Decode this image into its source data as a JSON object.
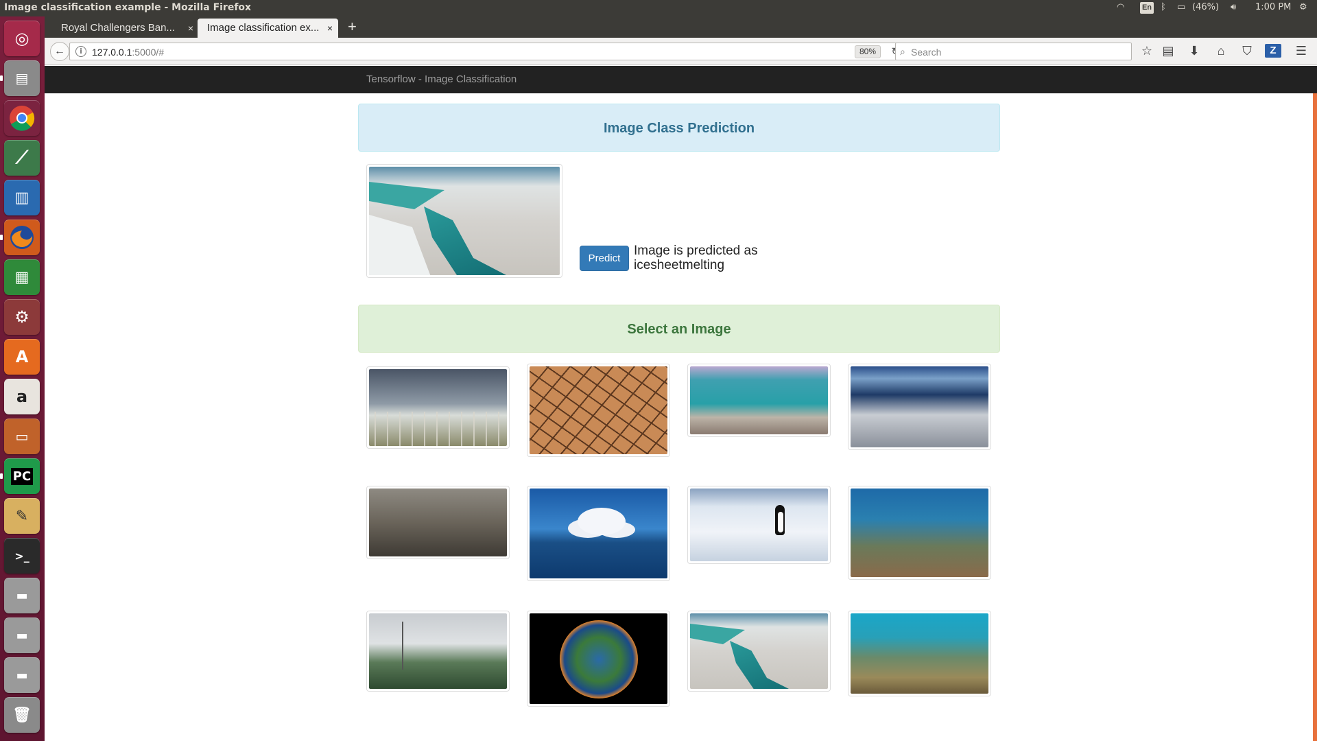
{
  "system_panel": {
    "window_title": "Image classification example - Mozilla Firefox",
    "keyboard_layout": "En",
    "battery": "(46%)",
    "clock": "1:00 PM"
  },
  "launcher": {
    "icons": [
      "ubuntu-dash-icon",
      "files-icon",
      "chrome-icon",
      "android-studio-icon",
      "libreoffice-writer-icon",
      "firefox-icon",
      "libreoffice-calc-icon",
      "system-settings-icon",
      "software-center-icon",
      "amazon-icon",
      "libreoffice-impress-icon",
      "pycharm-icon",
      "text-editor-icon",
      "terminal-icon",
      "drive-icon",
      "drive-icon",
      "drive-icon",
      "trash-icon"
    ]
  },
  "browser": {
    "tabs": [
      {
        "label": "Royal Challengers Ban...",
        "active": false
      },
      {
        "label": "Image classification ex...",
        "active": true
      }
    ],
    "close_glyph": "×",
    "new_tab_glyph": "+",
    "url_host": "127.0.0.1",
    "url_rest": ":5000/#",
    "zoom": "80%",
    "search_placeholder": "Search"
  },
  "page": {
    "brand": "Tensorflow - Image Classification",
    "prediction_heading": "Image Class Prediction",
    "predict_button": "Predict",
    "prediction_result": "Image is predicted as icesheetmelting",
    "select_heading": "Select an Image",
    "selected_image": "ice-sheet-melting",
    "gallery": [
      [
        "dead-forest-storm",
        "cracked-dry-earth",
        "bleached-coral-underwater",
        "bleached-coral-reef"
      ],
      [
        "polluted-ruined-city",
        "ocean-cloud",
        "penguin-on-ice",
        "coral-reef-seaweed"
      ],
      [
        "dying-forest-tower",
        "burning-earth",
        "ice-sheet-melting",
        "healthy-coral-reef"
      ]
    ]
  }
}
